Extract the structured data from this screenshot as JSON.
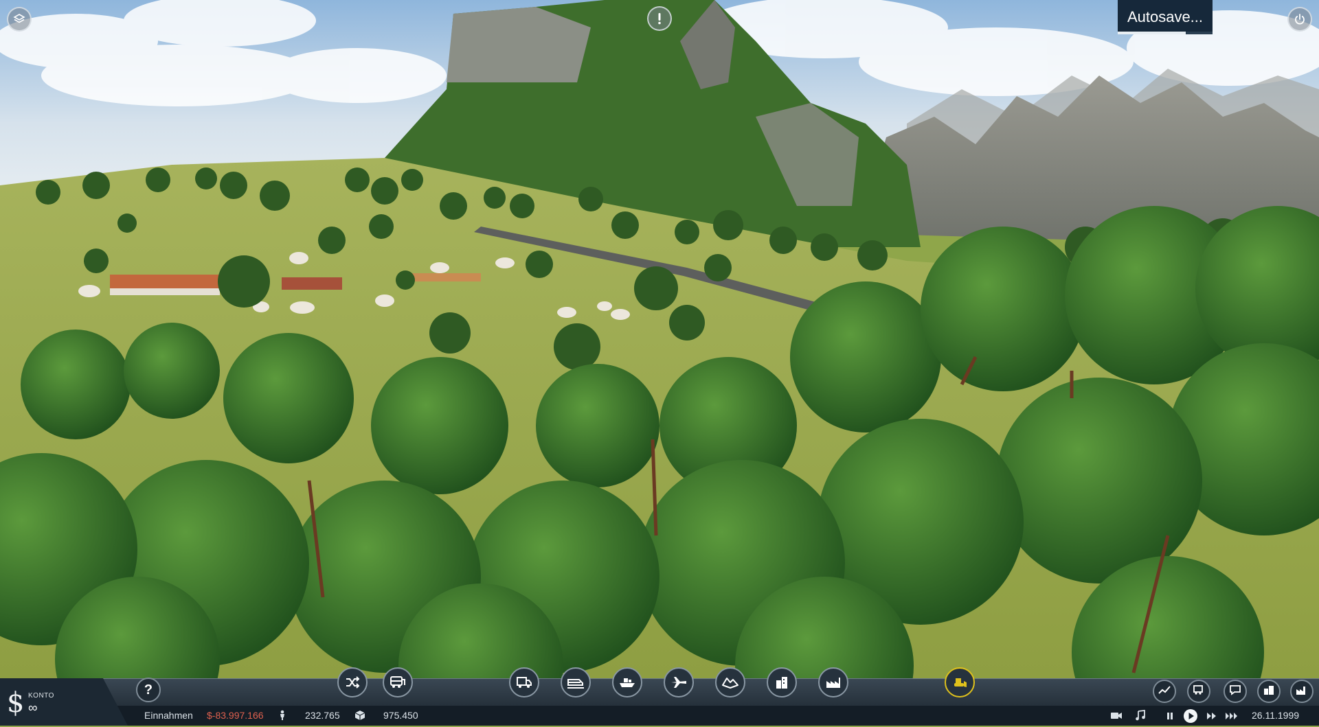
{
  "overlay": {
    "layers_icon": "layers-icon",
    "alert_icon": "exclamation-icon",
    "power_icon": "power-icon",
    "autosave_label": "Autosave...",
    "autosave_progress": 0.72
  },
  "account": {
    "label": "KONTO",
    "value": "∞",
    "icon": "dollar-icon"
  },
  "toolbar": {
    "help_label": "?",
    "tools": [
      {
        "name": "lines-button",
        "icon": "shuffle-icon"
      },
      {
        "name": "vehicle-depot-button",
        "icon": "bus-icon"
      },
      {
        "name": "road-transport-button",
        "icon": "truck-icon"
      },
      {
        "name": "rail-transport-button",
        "icon": "train-icon"
      },
      {
        "name": "water-transport-button",
        "icon": "ship-icon"
      },
      {
        "name": "air-transport-button",
        "icon": "plane-icon"
      },
      {
        "name": "terrain-button",
        "icon": "terrain-icon"
      },
      {
        "name": "town-button",
        "icon": "city-icon"
      },
      {
        "name": "industry-button",
        "icon": "factory-icon"
      },
      {
        "name": "bulldoze-button",
        "icon": "bulldozer-icon"
      }
    ],
    "right_tools": [
      {
        "name": "stats-button",
        "icon": "chart-line-icon"
      },
      {
        "name": "vehicles-button",
        "icon": "vehicle-list-icon"
      },
      {
        "name": "messages-button",
        "icon": "messages-icon"
      },
      {
        "name": "towns-button",
        "icon": "towns-icon"
      },
      {
        "name": "industries-button",
        "icon": "industries-icon"
      }
    ]
  },
  "status": {
    "income_label": "Einnahmen",
    "income_value": "$-83.997.166",
    "passengers_value": "232.765",
    "cargo_value": "975.450",
    "date": "26.11.1999",
    "colors": {
      "negative": "#e0614f",
      "accent": "#e0c21c"
    }
  }
}
